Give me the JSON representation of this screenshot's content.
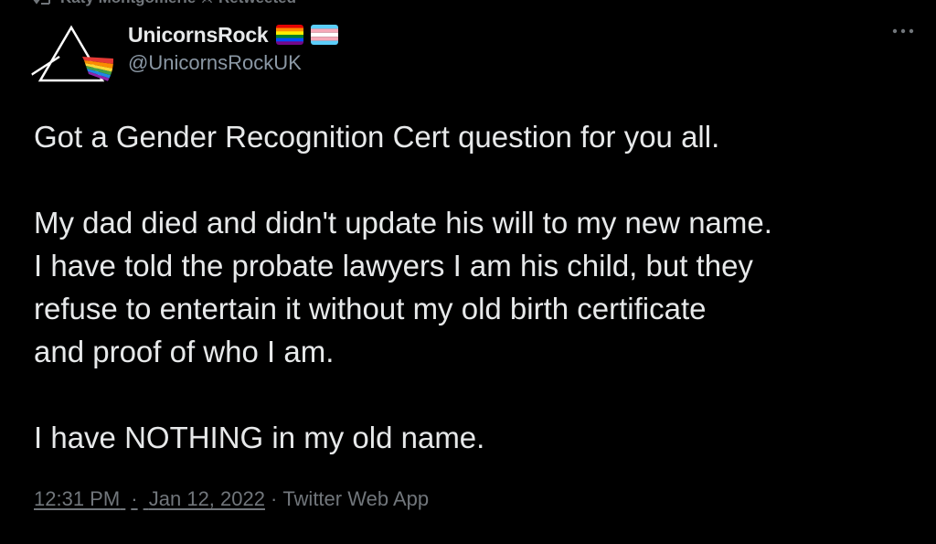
{
  "retweet": {
    "label": "Katy Montgomerie ⚔ Retweeted"
  },
  "tweet": {
    "display_name": "UnicornsRock",
    "handle": "@UnicornsRockUK",
    "paragraphs": [
      "Got a Gender Recognition Cert question for you all.",
      "My dad died and didn't update his will to my new name.\nI have told the probate lawyers I am his child, but they\nrefuse to entertain it without my old birth certificate\nand proof of who I am.",
      "I have NOTHING in my old name."
    ],
    "time": "12:31 PM",
    "separator": "·",
    "date": "Jan 12, 2022",
    "source": "Twitter Web App"
  },
  "icons": {
    "avatar": "prism-rainbow-avatar",
    "flag_1": "rainbow-flag-icon",
    "flag_2": "transgender-flag-icon",
    "more": "more-options-icon",
    "retweet": "retweet-icon"
  },
  "colors": {
    "background": "#000000",
    "text_primary": "#e7e9ea",
    "text_secondary": "#71767b",
    "handle": "#8b98a5"
  }
}
